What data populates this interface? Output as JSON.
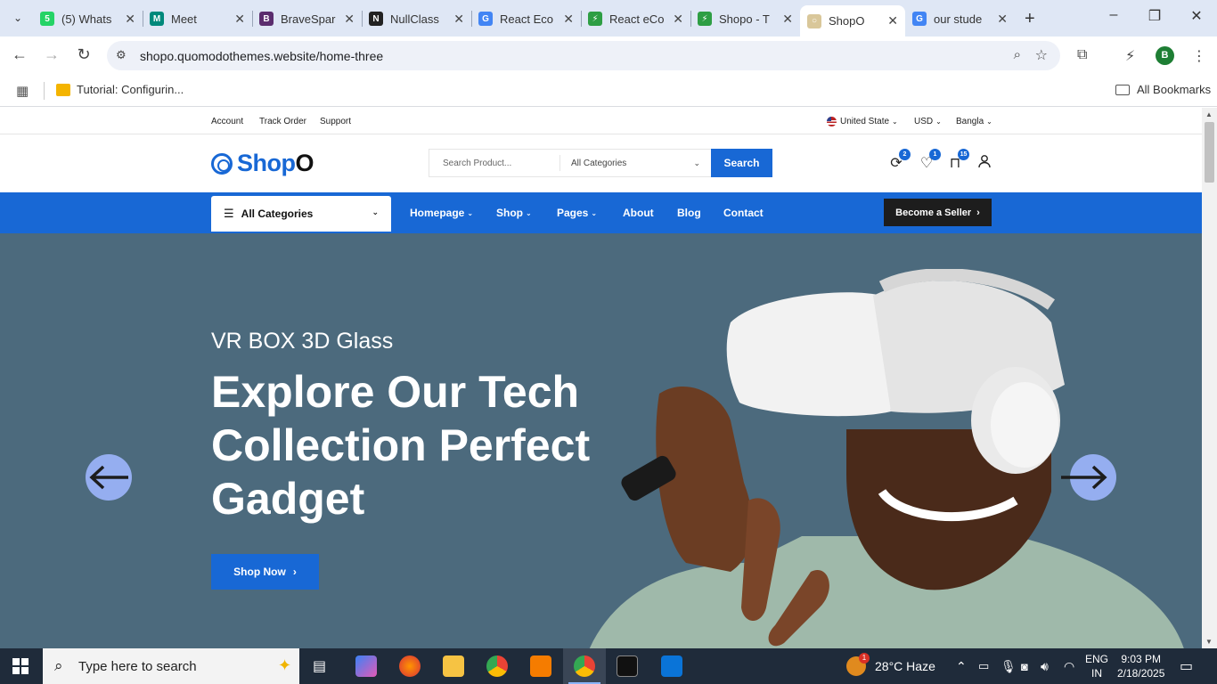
{
  "browser": {
    "tabs": [
      {
        "title": "(5) Whats",
        "fav_color": "#25d366",
        "fav_glyph": "5"
      },
      {
        "title": "Meet",
        "fav_color": "#00897b",
        "fav_glyph": "M"
      },
      {
        "title": "BraveSpar",
        "fav_color": "#5b2d6e",
        "fav_glyph": "B"
      },
      {
        "title": "NullClass",
        "fav_color": "#222222",
        "fav_glyph": "N"
      },
      {
        "title": "React Eco",
        "fav_color": "#4285f4",
        "fav_glyph": "G"
      },
      {
        "title": "React eCo",
        "fav_color": "#2e9e44",
        "fav_glyph": "⚡"
      },
      {
        "title": "Shopo - T",
        "fav_color": "#2e9e44",
        "fav_glyph": "⚡"
      },
      {
        "title": "ShopO",
        "fav_color": "#d9c79a",
        "fav_glyph": "○"
      },
      {
        "title": "our stude",
        "fav_color": "#4285f4",
        "fav_glyph": "G"
      }
    ],
    "active_tab_index": 7,
    "url": "shopo.quomodothemes.website/home-three",
    "profile_initial": "B",
    "bookmark": "Tutorial: Configurin...",
    "all_bookmarks": "All Bookmarks"
  },
  "topbar": {
    "links": [
      "Account",
      "Track Order",
      "Support"
    ],
    "country": "United State",
    "currency": "USD",
    "language": "Bangla"
  },
  "header": {
    "logo_main": "Shop",
    "logo_end": "O",
    "search_placeholder": "Search Product...",
    "category_select": "All Categories",
    "search_button": "Search",
    "compare_count": "2",
    "wishlist_count": "1",
    "cart_count": "15"
  },
  "nav": {
    "all_categories": "All Categories",
    "links": [
      "Homepage",
      "Shop",
      "Pages",
      "About",
      "Blog",
      "Contact"
    ],
    "seller_button": "Become a Seller"
  },
  "hero": {
    "subtitle": "VR BOX 3D Glass",
    "title": "Explore Our Tech Collection Perfect Gadget",
    "cta": "Shop Now",
    "bg_color": "#4c6a7d"
  },
  "taskbar": {
    "search_placeholder": "Type here to search",
    "weather": "28°C  Haze",
    "weather_badge": "1",
    "lang_top": "ENG",
    "lang_bottom": "IN",
    "time": "9:03 PM",
    "date": "2/18/2025"
  },
  "colors": {
    "brand": "#1868d5",
    "dark": "#1d1d1d"
  }
}
